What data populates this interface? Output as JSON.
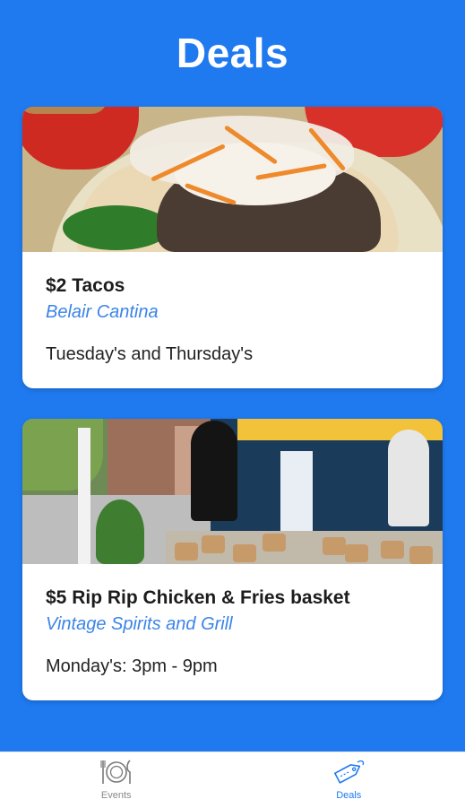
{
  "header": {
    "title": "Deals"
  },
  "deals": [
    {
      "title": "$2 Tacos",
      "venue": "Belair Cantina",
      "schedule": "Tuesday's and Thursday's",
      "image": "tacos-photo"
    },
    {
      "title": "$5 Rip Rip Chicken & Fries basket",
      "venue": "Vintage Spirits and Grill",
      "schedule": "Monday's: 3pm - 9pm",
      "image": "patio-photo"
    }
  ],
  "tabs": [
    {
      "label": "Events",
      "icon": "plate-utensils-icon",
      "active": false
    },
    {
      "label": "Deals",
      "icon": "price-tag-icon",
      "active": true
    }
  ],
  "colors": {
    "background": "#1f7af0",
    "accent": "#1f7af0",
    "venue_link": "#3b84e8",
    "tab_inactive": "#8a8a8a"
  }
}
